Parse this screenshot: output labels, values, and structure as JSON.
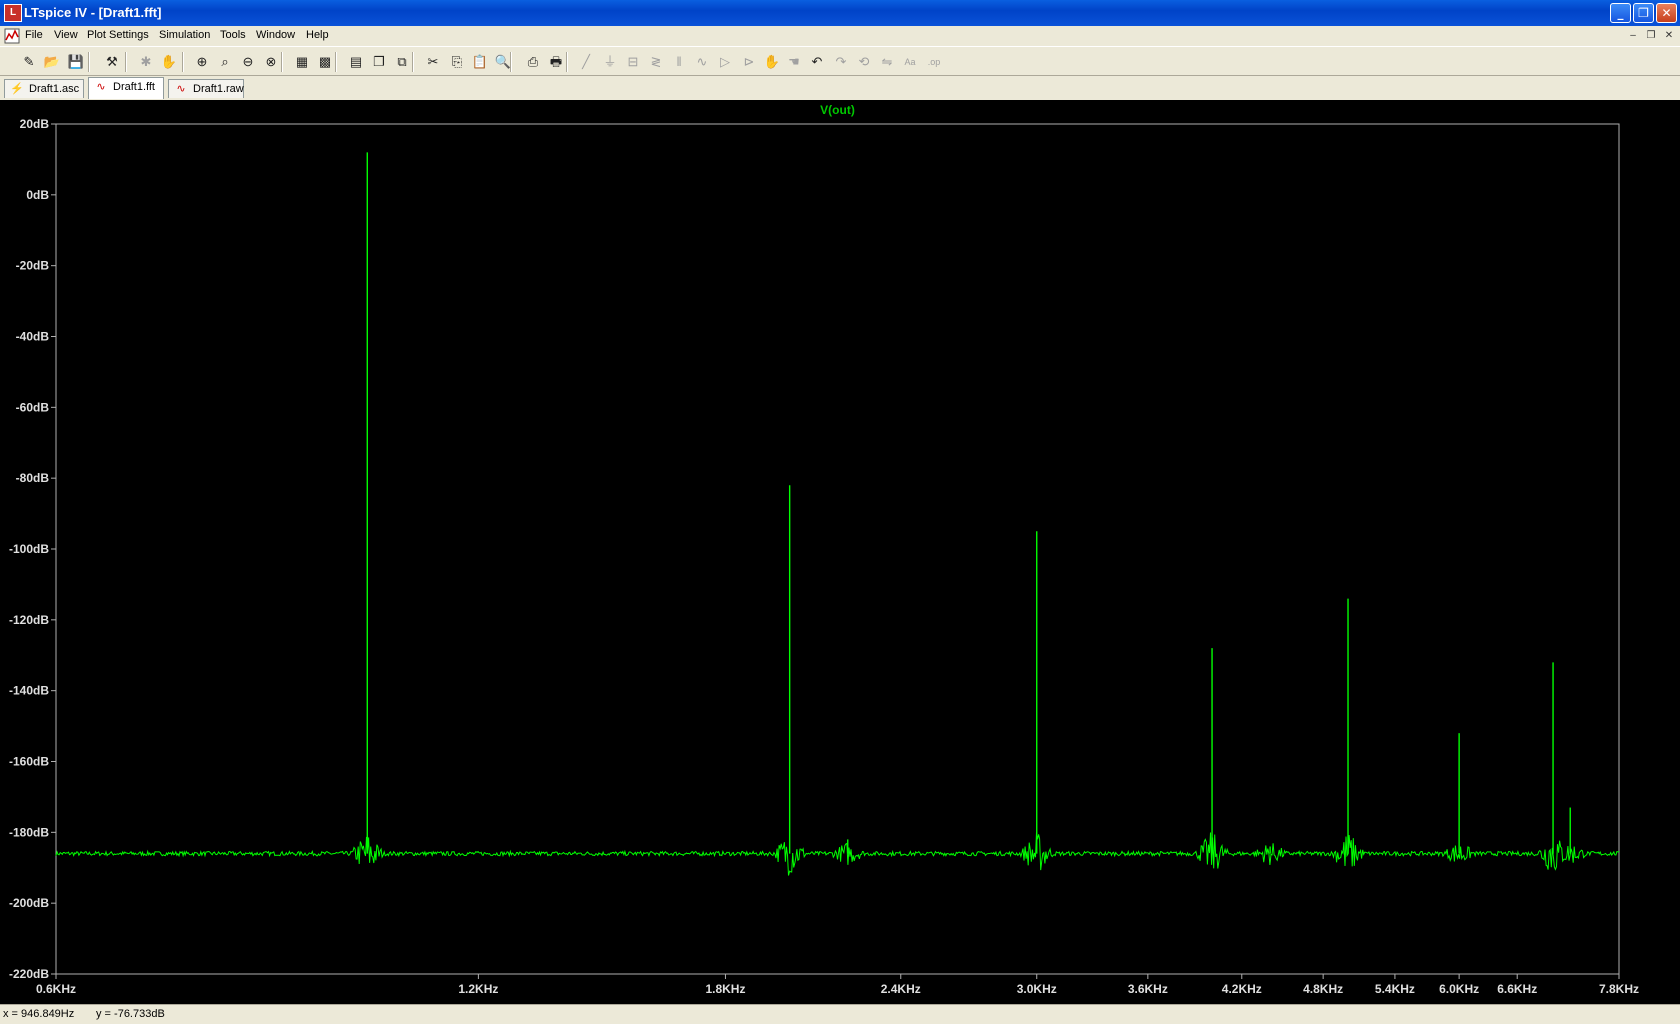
{
  "window": {
    "title": "LTspice IV - [Draft1.fft]",
    "app_icon_letter": "L"
  },
  "menu": {
    "items": [
      "File",
      "View",
      "Plot Settings",
      "Simulation",
      "Tools",
      "Window",
      "Help"
    ]
  },
  "toolbar": {
    "buttons": [
      {
        "icon": "new-schematic-icon",
        "glyph": "✎",
        "enabled": true
      },
      {
        "icon": "open-icon",
        "glyph": "📂",
        "enabled": true
      },
      {
        "icon": "save-icon",
        "glyph": "💾",
        "enabled": true
      },
      {
        "icon": "control-panel-icon",
        "glyph": "⚒",
        "enabled": true
      },
      {
        "icon": "run-icon",
        "glyph": "✱",
        "enabled": false
      },
      {
        "icon": "halt-icon",
        "glyph": "✋",
        "enabled": false
      },
      {
        "icon": "zoom-in-icon",
        "glyph": "⊕",
        "enabled": true
      },
      {
        "icon": "pan-icon",
        "glyph": "⌕",
        "enabled": true
      },
      {
        "icon": "zoom-out-icon",
        "glyph": "⊖",
        "enabled": true
      },
      {
        "icon": "zoom-fit-icon",
        "glyph": "⊗",
        "enabled": true
      },
      {
        "icon": "autorange-icon",
        "glyph": "▦",
        "enabled": true
      },
      {
        "icon": "grid-icon",
        "glyph": "▩",
        "enabled": true
      },
      {
        "icon": "tile-horizontal-icon",
        "glyph": "▤",
        "enabled": true
      },
      {
        "icon": "cascade-icon",
        "glyph": "❐",
        "enabled": true
      },
      {
        "icon": "close-all-icon",
        "glyph": "⧉",
        "enabled": true
      },
      {
        "icon": "cut-icon",
        "glyph": "✂",
        "enabled": true
      },
      {
        "icon": "copy-icon",
        "glyph": "⎘",
        "enabled": true
      },
      {
        "icon": "paste-icon",
        "glyph": "📋",
        "enabled": true
      },
      {
        "icon": "find-icon",
        "glyph": "🔍",
        "enabled": true
      },
      {
        "icon": "print-preview-icon",
        "glyph": "⎙",
        "enabled": true
      },
      {
        "icon": "print-icon",
        "glyph": "🖶",
        "enabled": true
      },
      {
        "icon": "wire-icon",
        "glyph": "╱",
        "enabled": false
      },
      {
        "icon": "ground-icon",
        "glyph": "⏚",
        "enabled": false
      },
      {
        "icon": "label-net-icon",
        "glyph": "⊟",
        "enabled": false
      },
      {
        "icon": "resistor-icon",
        "glyph": "≷",
        "enabled": false
      },
      {
        "icon": "capacitor-icon",
        "glyph": "‖",
        "enabled": false
      },
      {
        "icon": "inductor-icon",
        "glyph": "∿",
        "enabled": false
      },
      {
        "icon": "diode-icon",
        "glyph": "▷",
        "enabled": false
      },
      {
        "icon": "component-icon",
        "glyph": "⊳",
        "enabled": false
      },
      {
        "icon": "move-icon",
        "glyph": "✋",
        "enabled": false
      },
      {
        "icon": "drag-icon",
        "glyph": "☚",
        "enabled": false
      },
      {
        "icon": "undo-icon",
        "glyph": "↶",
        "enabled": true
      },
      {
        "icon": "redo-icon",
        "glyph": "↷",
        "enabled": false
      },
      {
        "icon": "rotate-icon",
        "glyph": "⟲",
        "enabled": false
      },
      {
        "icon": "mirror-icon",
        "glyph": "⇋",
        "enabled": false
      },
      {
        "icon": "text-icon",
        "glyph": "Aa",
        "enabled": false
      },
      {
        "icon": "spice-directive-icon",
        "glyph": ".op",
        "enabled": false
      }
    ]
  },
  "tabs": [
    {
      "label": "Draft1.asc",
      "icon": "schematic-tab-icon",
      "glyph": "⚡",
      "active": false
    },
    {
      "label": "Draft1.fft",
      "icon": "waveform-tab-icon",
      "glyph": "∿",
      "active": true
    },
    {
      "label": "Draft1.raw",
      "icon": "waveform-tab-icon",
      "glyph": "∿",
      "active": false
    }
  ],
  "colors": {
    "trace": "#00ff00",
    "trace_title": "#00c800",
    "background": "#000000",
    "axis": "#b0b0b0"
  },
  "chart_data": {
    "type": "line",
    "title": "V(out)",
    "x_scale": "log",
    "xlim_hz": [
      600,
      7800
    ],
    "ylim_db": [
      -220,
      20
    ],
    "yticks": [
      20,
      0,
      -20,
      -40,
      -60,
      -80,
      -100,
      -120,
      -140,
      -160,
      -180,
      -200,
      -220
    ],
    "ytick_labels": [
      "20dB",
      "0dB",
      "-20dB",
      "-40dB",
      "-60dB",
      "-80dB",
      "-100dB",
      "-120dB",
      "-140dB",
      "-160dB",
      "-180dB",
      "-200dB",
      "-220dB"
    ],
    "xticks_hz": [
      600,
      1200,
      1800,
      2400,
      3000,
      3600,
      4200,
      4800,
      5400,
      6000,
      6600,
      7800
    ],
    "xtick_labels": [
      "0.6KHz",
      "1.2KHz",
      "1.8KHz",
      "2.4KHz",
      "3.0KHz",
      "3.6KHz",
      "4.2KHz",
      "4.8KHz",
      "5.4KHz",
      "6.0KHz",
      "6.6KHz",
      "7.8KHz"
    ],
    "noise_floor_db": -186,
    "series": [
      {
        "name": "V(out)",
        "peaks": [
          {
            "freq_hz": 1000,
            "db": 12
          },
          {
            "freq_hz": 2000,
            "db": -82
          },
          {
            "freq_hz": 2200,
            "db": -182
          },
          {
            "freq_hz": 3000,
            "db": -95
          },
          {
            "freq_hz": 4000,
            "db": -128
          },
          {
            "freq_hz": 4400,
            "db": -184
          },
          {
            "freq_hz": 5000,
            "db": -114
          },
          {
            "freq_hz": 6000,
            "db": -152
          },
          {
            "freq_hz": 7000,
            "db": -132
          },
          {
            "freq_hz": 7200,
            "db": -173
          }
        ]
      }
    ]
  },
  "status": {
    "x_readout": "x = 946.849Hz",
    "y_readout": "y = -76.733dB"
  }
}
